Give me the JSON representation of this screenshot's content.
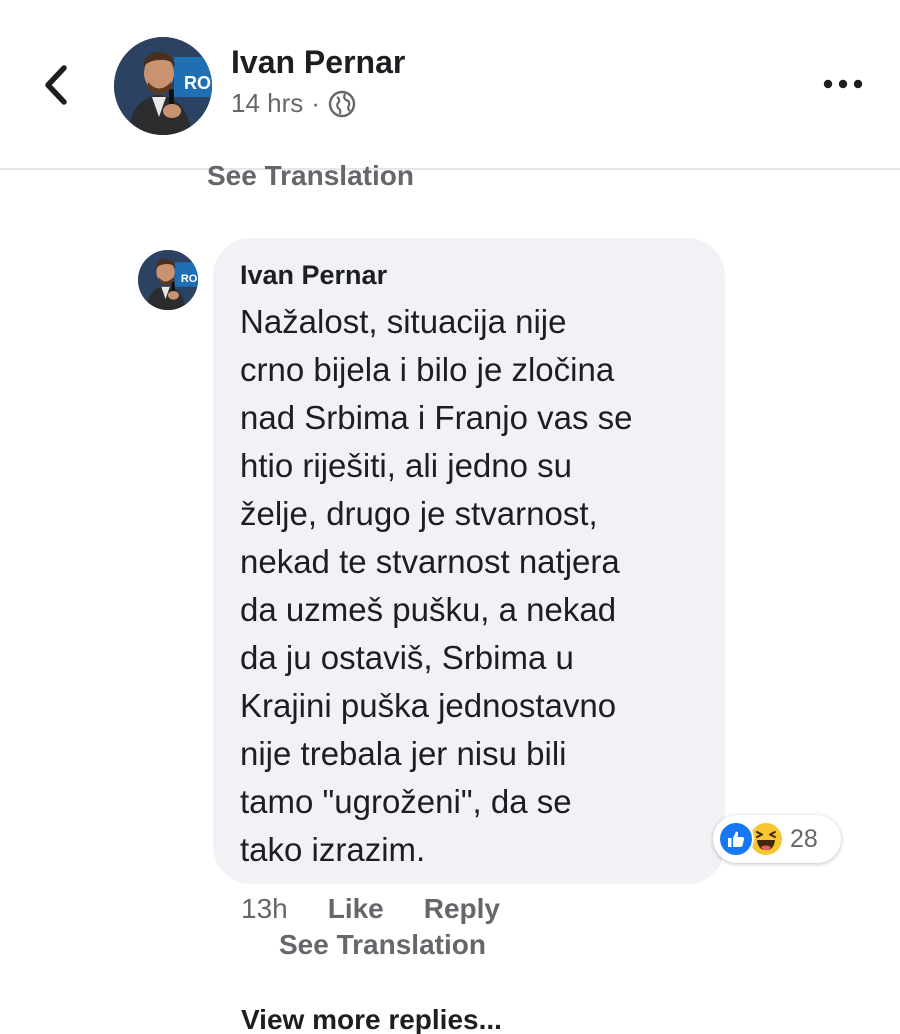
{
  "header": {
    "author_name": "Ivan Pernar",
    "timestamp": "14 hrs",
    "separator": "·",
    "privacy_icon": "globe-icon",
    "back_icon": "chevron-left-icon",
    "more_icon": "ellipsis-icon"
  },
  "post": {
    "see_translation": "See Translation"
  },
  "comment": {
    "author_name": "Ivan Pernar",
    "text_lines": [
      "Nažalost, situacija nije",
      "crno bijela i bilo je zločina",
      "nad Srbima i Franjo vas se",
      "htio riješiti, ali jedno su",
      "želje, drugo je stvarnost,",
      "nekad te stvarnost natjera",
      "da uzmeš pušku, a nekad",
      "da ju ostaviš, Srbima u",
      "Krajini puška jednostavno",
      "nije trebala jer nisu bili",
      "tamo \"ugroženi\", da se",
      "tako izrazim."
    ],
    "reactions": {
      "icons": [
        "like-reaction-icon",
        "haha-reaction-icon"
      ],
      "count": "28"
    },
    "time": "13h",
    "like_label": "Like",
    "reply_label": "Reply",
    "see_translation": "See Translation"
  },
  "footer": {
    "view_more_replies": "View more replies..."
  },
  "colors": {
    "primary_text": "#1c1e21",
    "secondary_text": "#65676b",
    "bubble_bg": "#f0f2f5",
    "like_blue": "#1877f2",
    "haha_yellow": "#f7c631"
  }
}
